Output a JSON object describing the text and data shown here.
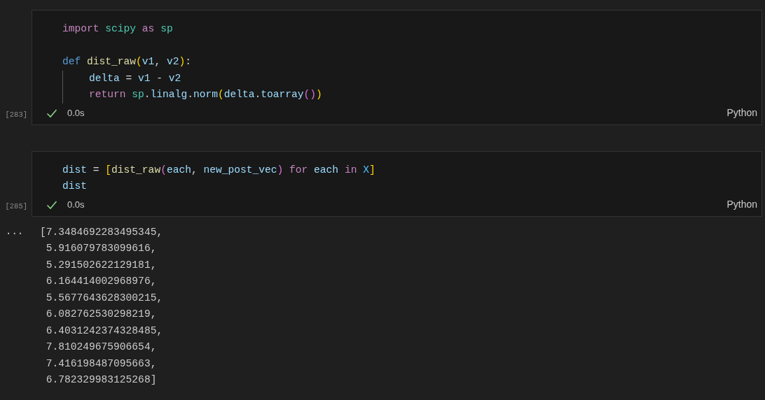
{
  "cells": [
    {
      "execution_count": "[283]",
      "succeeded": true,
      "time": "0.0s",
      "language": "Python",
      "lines": [
        {
          "indent_guide": false,
          "blank_line_before": false,
          "tokens": [
            {
              "text": "import ",
              "kind": "keyword"
            },
            {
              "text": "scipy ",
              "kind": "module"
            },
            {
              "text": "as ",
              "kind": "keyword"
            },
            {
              "text": "sp",
              "kind": "module"
            }
          ]
        },
        {
          "indent_guide": false,
          "blank_line_before": true,
          "tokens": [
            {
              "text": "def ",
              "kind": "storage"
            },
            {
              "text": "dist_raw",
              "kind": "function"
            },
            {
              "text": "(",
              "kind": "bracket1"
            },
            {
              "text": "v1",
              "kind": "variable"
            },
            {
              "text": ", ",
              "kind": "plain"
            },
            {
              "text": "v2",
              "kind": "variable"
            },
            {
              "text": ")",
              "kind": "bracket1"
            },
            {
              "text": ":",
              "kind": "plain"
            }
          ]
        },
        {
          "indent_guide": true,
          "blank_line_before": false,
          "tokens": [
            {
              "text": "delta ",
              "kind": "variable"
            },
            {
              "text": "= ",
              "kind": "plain"
            },
            {
              "text": "v1 ",
              "kind": "variable"
            },
            {
              "text": "- ",
              "kind": "plain"
            },
            {
              "text": "v2",
              "kind": "variable"
            }
          ]
        },
        {
          "indent_guide": true,
          "blank_line_before": false,
          "tokens": [
            {
              "text": "return ",
              "kind": "keyword"
            },
            {
              "text": "sp",
              "kind": "module"
            },
            {
              "text": ".",
              "kind": "plain"
            },
            {
              "text": "linalg",
              "kind": "variable"
            },
            {
              "text": ".",
              "kind": "plain"
            },
            {
              "text": "norm",
              "kind": "variable"
            },
            {
              "text": "(",
              "kind": "bracket1"
            },
            {
              "text": "delta",
              "kind": "variable"
            },
            {
              "text": ".",
              "kind": "plain"
            },
            {
              "text": "toarray",
              "kind": "variable"
            },
            {
              "text": "(",
              "kind": "bracket2"
            },
            {
              "text": ")",
              "kind": "bracket2"
            },
            {
              "text": ")",
              "kind": "bracket1"
            }
          ]
        }
      ]
    },
    {
      "execution_count": "[285]",
      "succeeded": true,
      "time": "0.0s",
      "language": "Python",
      "lines": [
        {
          "indent_guide": false,
          "blank_line_before": false,
          "tokens": [
            {
              "text": "dist ",
              "kind": "variable"
            },
            {
              "text": "= ",
              "kind": "plain"
            },
            {
              "text": "[",
              "kind": "bracket1"
            },
            {
              "text": "dist_raw",
              "kind": "function"
            },
            {
              "text": "(",
              "kind": "bracket2"
            },
            {
              "text": "each",
              "kind": "variable"
            },
            {
              "text": ", ",
              "kind": "plain"
            },
            {
              "text": "new_post_vec",
              "kind": "variable"
            },
            {
              "text": ") ",
              "kind": "bracket2"
            },
            {
              "text": "for ",
              "kind": "keyword"
            },
            {
              "text": "each ",
              "kind": "variable"
            },
            {
              "text": "in ",
              "kind": "keyword"
            },
            {
              "text": "X",
              "kind": "constant"
            },
            {
              "text": "]",
              "kind": "bracket1"
            }
          ]
        },
        {
          "indent_guide": false,
          "blank_line_before": false,
          "tokens": [
            {
              "text": "dist",
              "kind": "variable"
            }
          ]
        }
      ],
      "output": {
        "menu": "···",
        "lines": [
          "[7.3484692283495345,",
          " 5.916079783099616,",
          " 5.291502622129181,",
          " 6.164414002968976,",
          " 5.5677643628300215,",
          " 6.082762530298219,",
          " 6.4031242374328485,",
          " 7.810249675906654,",
          " 7.416198487095663,",
          " 6.782329983125268]"
        ]
      }
    }
  ]
}
